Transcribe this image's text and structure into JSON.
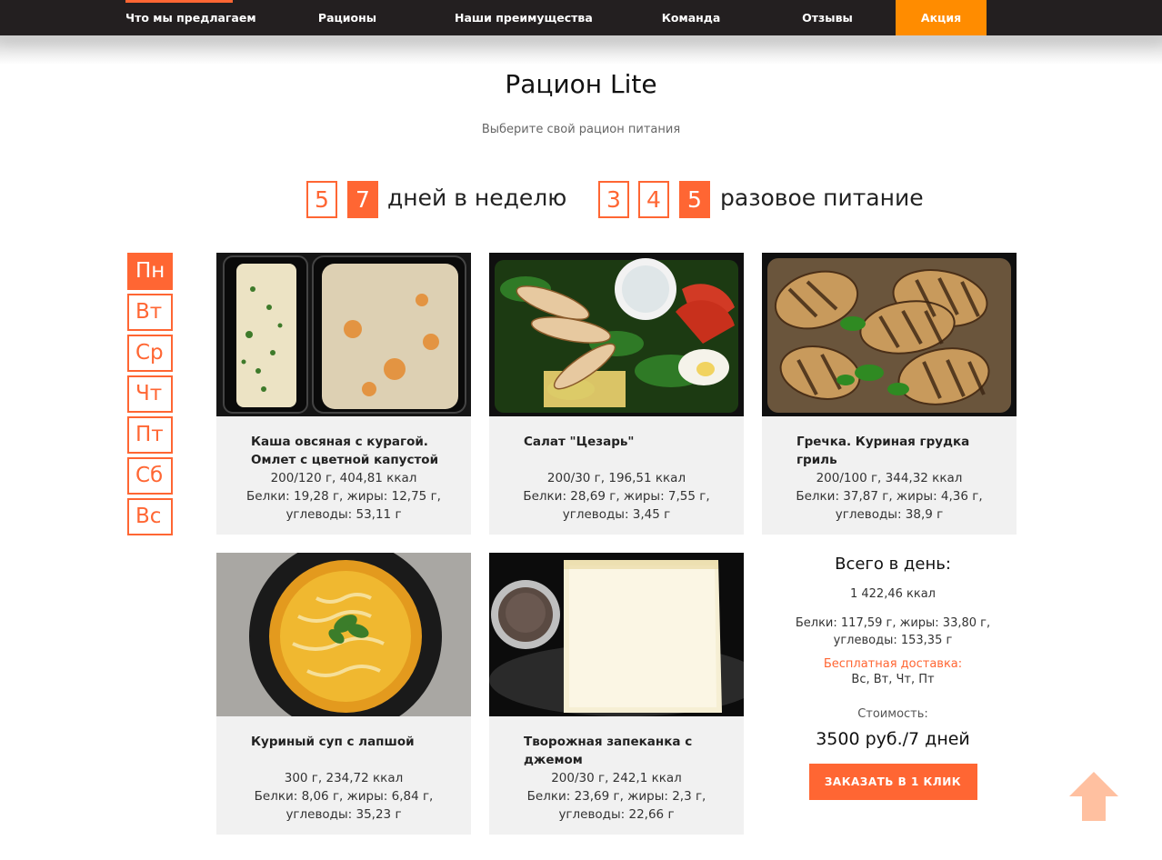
{
  "nav": {
    "items": [
      {
        "label": "Что мы предлагаем"
      },
      {
        "label": "Рационы"
      },
      {
        "label": "Наши преимущества"
      },
      {
        "label": "Команда"
      },
      {
        "label": "Отзывы"
      },
      {
        "label": "Акция"
      }
    ]
  },
  "page": {
    "title": "Рацион Lite",
    "subtitle": "Выберите свой рацион питания"
  },
  "days_per_week": {
    "options": [
      "5",
      "7"
    ],
    "selected": "7",
    "label": "дней в неделю"
  },
  "meals_per_day": {
    "options": [
      "3",
      "4",
      "5"
    ],
    "selected": "5",
    "label": "разовое питание"
  },
  "weekdays": {
    "items": [
      "Пн",
      "Вт",
      "Ср",
      "Чт",
      "Пт",
      "Сб",
      "Вс"
    ],
    "selected": "Пн"
  },
  "meals": [
    {
      "name": "Каша овсяная с курагой. Омлет с цветной капустой",
      "weight_kcal": "200/120 г, 404,81 ккал",
      "macros1": "Белки: 19,28 г, жиры: 12,75 г,",
      "macros2": "углеводы: 53,11 г"
    },
    {
      "name": "Салат \"Цезарь\"",
      "weight_kcal": "200/30 г, 196,51 ккал",
      "macros1": "Белки: 28,69 г, жиры: 7,55 г,",
      "macros2": "углеводы: 3,45 г"
    },
    {
      "name": "Гречка. Куриная грудка гриль",
      "weight_kcal": "200/100 г, 344,32 ккал",
      "macros1": "Белки: 37,87 г, жиры: 4,36 г,",
      "macros2": "углеводы: 38,9 г"
    },
    {
      "name": "Куриный суп с лапшой",
      "weight_kcal": "300 г, 234,72 ккал",
      "macros1": "Белки: 8,06 г, жиры: 6,84 г,",
      "macros2": "углеводы: 35,23 г"
    },
    {
      "name": "Творожная запеканка с джемом",
      "weight_kcal": "200/30 г, 242,1 ккал",
      "macros1": "Белки: 23,69 г, жиры: 2,3 г,",
      "macros2": "углеводы: 22,66 г"
    }
  ],
  "summary": {
    "title": "Всего в день:",
    "kcal": "1 422,46 ккал",
    "macros1": "Белки: 117,59 г, жиры: 33,80 г,",
    "macros2": "углеводы: 153,35 г",
    "delivery_label": "Бесплатная доставка:",
    "delivery_days": "Вс, Вт, Чт, Пт",
    "cost_label": "Стоимость:",
    "price": "3500 руб./7 дней",
    "order_button": "ЗАКАЗАТЬ В 1 КЛИК"
  },
  "colors": {
    "accent": "#ff6633",
    "promo": "#ff8c00",
    "nav_bg": "#231f20",
    "card_bg": "#f1f1f1",
    "scroll_up": "#ffc0a0"
  },
  "icons": {
    "scroll_up": "arrow-up-icon"
  }
}
